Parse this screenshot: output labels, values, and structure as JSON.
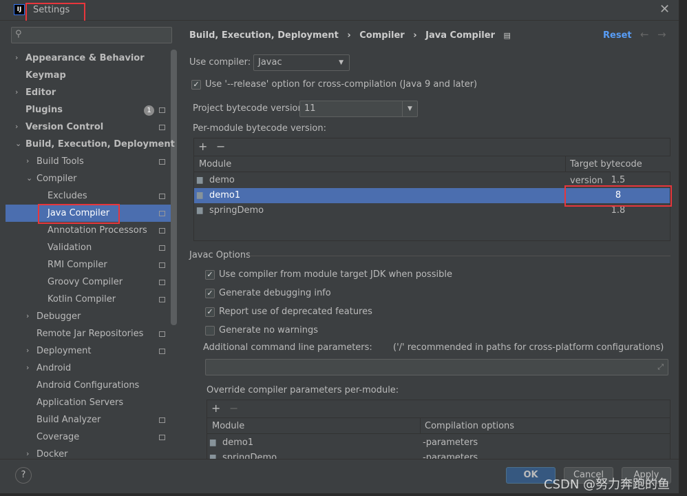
{
  "window": {
    "title": "Settings",
    "logo": "IJ"
  },
  "search": {
    "placeholder": ""
  },
  "sidebar": {
    "items": [
      {
        "label": "Appearance & Behavior",
        "bold": true,
        "chevron": ">"
      },
      {
        "label": "Keymap",
        "bold": true
      },
      {
        "label": "Editor",
        "bold": true,
        "chevron": ">"
      },
      {
        "label": "Plugins",
        "bold": true,
        "badge": "1"
      },
      {
        "label": "Version Control",
        "bold": true,
        "chevron": ">"
      },
      {
        "label": "Build, Execution, Deployment",
        "bold": true,
        "chevron": "v"
      },
      {
        "label": "Build Tools",
        "chevron": ">"
      },
      {
        "label": "Compiler",
        "chevron": "v"
      },
      {
        "label": "Excludes"
      },
      {
        "label": "Java Compiler"
      },
      {
        "label": "Annotation Processors"
      },
      {
        "label": "Validation"
      },
      {
        "label": "RMI Compiler"
      },
      {
        "label": "Groovy Compiler"
      },
      {
        "label": "Kotlin Compiler"
      },
      {
        "label": "Debugger",
        "chevron": ">"
      },
      {
        "label": "Remote Jar Repositories"
      },
      {
        "label": "Deployment",
        "chevron": ">"
      },
      {
        "label": "Android",
        "chevron": ">"
      },
      {
        "label": "Android Configurations"
      },
      {
        "label": "Application Servers"
      },
      {
        "label": "Build Analyzer"
      },
      {
        "label": "Coverage"
      },
      {
        "label": "Docker",
        "chevron": ">"
      }
    ]
  },
  "breadcrumb": [
    "Build, Execution, Deployment",
    "Compiler",
    "Java Compiler"
  ],
  "header": {
    "reset": "Reset",
    "back": "←",
    "forward": "→"
  },
  "compiler": {
    "use_label": "Use compiler:",
    "use_value": "Javac",
    "release_label": "Use '--release' option for cross-compilation (Java 9 and later)",
    "bytecode_label": "Project bytecode version:",
    "bytecode_value": "11",
    "per_module_label": "Per-module bytecode version:",
    "add": "+",
    "remove": "−",
    "table": {
      "headers": [
        "Module",
        "Target bytecode version"
      ],
      "rows": [
        [
          "demo",
          "1.5"
        ],
        [
          "demo1",
          "8"
        ],
        [
          "springDemo",
          "1.8"
        ]
      ]
    }
  },
  "javac": {
    "section": "Javac Options",
    "options": [
      {
        "label": "Use compiler from module target JDK when possible",
        "checked": true
      },
      {
        "label": "Generate debugging info",
        "checked": true
      },
      {
        "label": "Report use of deprecated features",
        "checked": true
      },
      {
        "label": "Generate no warnings",
        "checked": false
      }
    ],
    "params_label": "Additional command line parameters:",
    "params_hint": "('/' recommended in paths for cross-platform configurations)",
    "params_value": "",
    "override_label": "Override compiler parameters per-module:",
    "override_table": {
      "headers": [
        "Module",
        "Compilation options"
      ],
      "rows": [
        [
          "demo1",
          "-parameters"
        ],
        [
          "springDemo",
          "-parameters"
        ]
      ]
    }
  },
  "footer": {
    "help": "?",
    "ok": "OK",
    "cancel": "Cancel",
    "apply": "Apply"
  },
  "watermark": "CSDN @努力奔跑的鱼",
  "colors": {
    "selection": "#4b6eaf",
    "accent": "#589df6",
    "highlight": "#e8363c"
  }
}
